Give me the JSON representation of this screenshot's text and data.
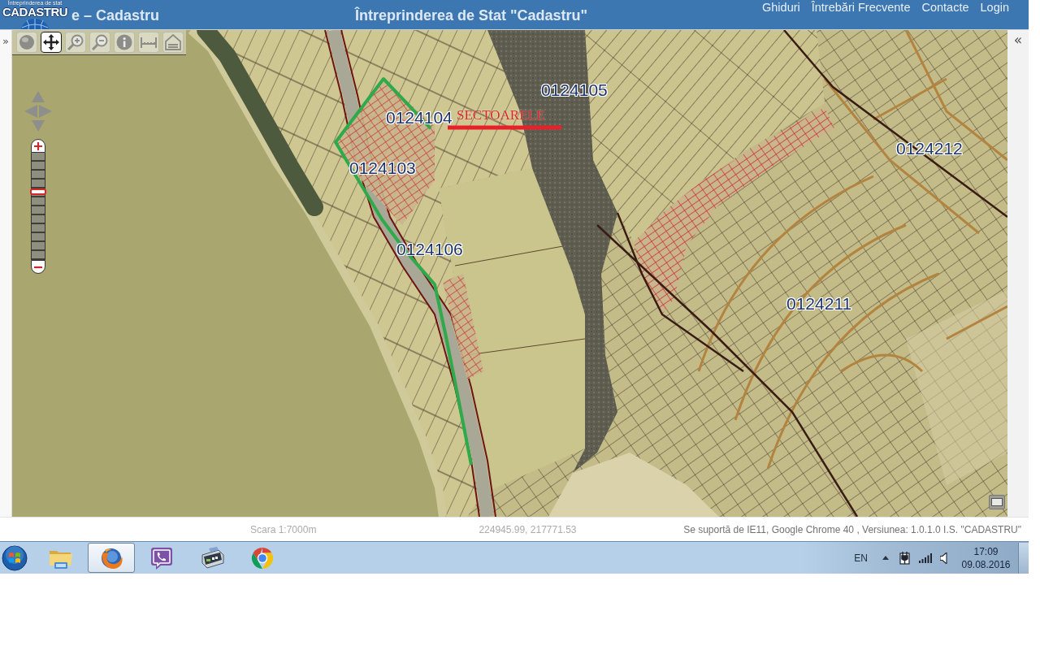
{
  "header": {
    "logo": {
      "subtitle": "Întreprinderea de stat",
      "name": "CADASTRU"
    },
    "app_title": "e – Cadastru",
    "org_title": "Întreprinderea de Stat \"Cadastru\"",
    "nav": [
      "Ghiduri",
      "Întrebări Frecvente",
      "Contacte",
      "Login"
    ]
  },
  "side_toggles": {
    "left": "»",
    "right": "«"
  },
  "map": {
    "tools": [
      {
        "kind": "globe",
        "selected": false
      },
      {
        "kind": "pan",
        "selected": true
      },
      {
        "kind": "zoomin",
        "selected": false
      },
      {
        "kind": "zoomout",
        "selected": false
      },
      {
        "kind": "info",
        "selected": false
      },
      {
        "kind": "measure",
        "selected": false
      },
      {
        "kind": "area",
        "selected": false
      }
    ],
    "zoom": {
      "level": 0.64
    },
    "labels": [
      {
        "kind": "parcel",
        "text": "0124105"
      },
      {
        "kind": "parcel",
        "text": "0124104"
      },
      {
        "kind": "sector",
        "text": "SECTOARELE"
      },
      {
        "kind": "parcel",
        "text": "0124212"
      },
      {
        "kind": "parcel",
        "text": "0124103"
      },
      {
        "kind": "parcel",
        "text": "0124106"
      },
      {
        "kind": "parcel",
        "text": "0124211"
      }
    ]
  },
  "status_bar": {
    "scale": "Scara 1:7000m",
    "coordinates": "224945.99, 217771.53",
    "version": "Se suportă de IE11, Google Chrome 40 , Versiunea: 1.0.1.0 I.S. \"CADASTRU\""
  },
  "taskbar": {
    "apps": [
      {
        "kind": "folder",
        "selected": false
      },
      {
        "kind": "fox",
        "selected": true
      },
      {
        "kind": "phone",
        "selected": false
      },
      {
        "kind": "device",
        "selected": false
      },
      {
        "kind": "wheel",
        "selected": false
      }
    ],
    "tray": {
      "language": "EN",
      "time": "17:09",
      "date": "09.08.2016"
    }
  }
}
